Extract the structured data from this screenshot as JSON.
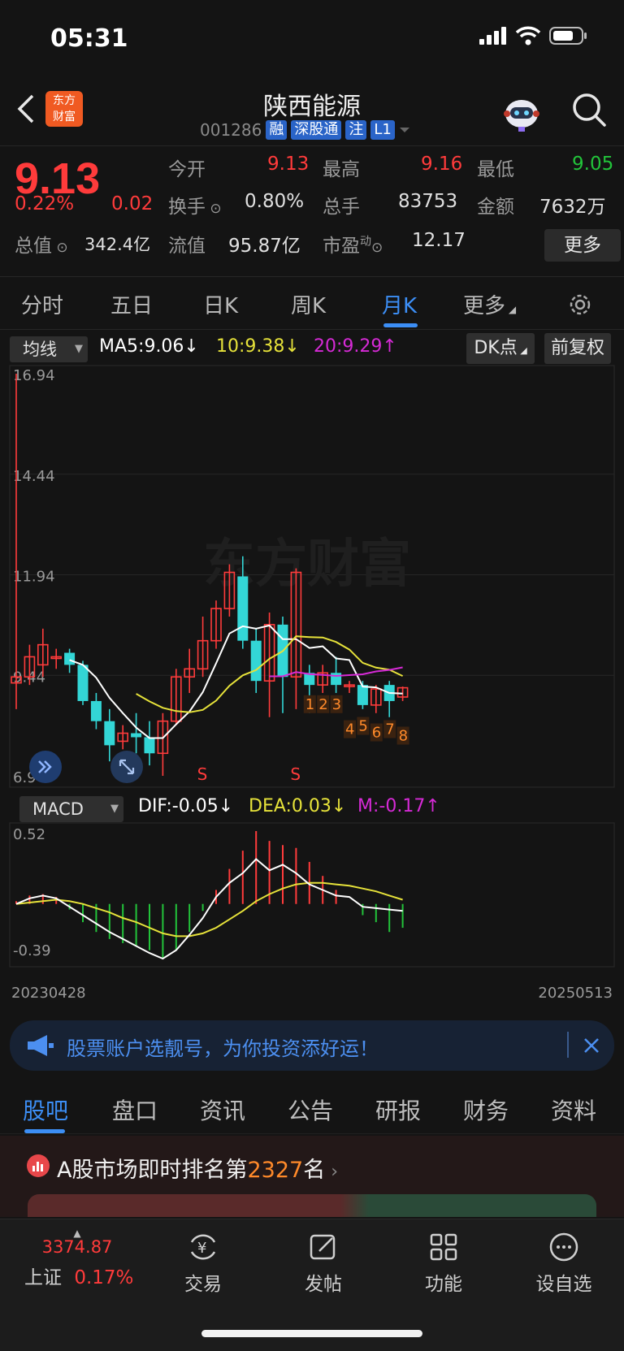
{
  "status": {
    "time": "05:31"
  },
  "header": {
    "title": "陕西能源",
    "logo_text_1": "东方",
    "logo_text_2": "财富",
    "code": "001286",
    "tags": [
      "融",
      "深股通",
      "注",
      "L1"
    ]
  },
  "quote": {
    "price": "9.13",
    "change_pct": "0.22%",
    "change": "0.02",
    "open_label": "今开",
    "open": "9.13",
    "high_label": "最高",
    "high": "9.16",
    "low_label": "最低",
    "low": "9.05",
    "turnover_label": "换手",
    "turnover": "0.80%",
    "volume_label": "总手",
    "volume": "83753",
    "amount_label": "金额",
    "amount": "7632万",
    "mcap_label": "总值",
    "mcap": "342.4亿",
    "float_label": "流值",
    "float": "95.87亿",
    "pe_label": "市盈",
    "pe_sup": "动",
    "pe": "12.17",
    "more": "更多"
  },
  "tabs": [
    "分时",
    "五日",
    "日K",
    "周K",
    "月K",
    "更多"
  ],
  "active_tab": "月K",
  "indicators": {
    "main_select": "均线",
    "ma5": "MA5:9.06↓",
    "ma10": "10:9.38↓",
    "ma20": "20:9.29↑",
    "dk_button": "DK点",
    "adjust_button": "前复权",
    "sub_select": "MACD",
    "dif": "DIF:-0.05↓",
    "dea": "DEA:0.03↓",
    "m": "M:-0.17↑"
  },
  "colors": {
    "up": "#ff3b3b",
    "down": "#33d6d6",
    "ma5": "#ffffff",
    "ma10": "#e6e23a",
    "ma20": "#d62ad6",
    "accent": "#3c8ef5"
  },
  "chart_data": [
    {
      "type": "candlestick",
      "title": "",
      "y_ticks": [
        "16.94",
        "14.44",
        "11.94",
        "9.44",
        "6.94"
      ],
      "ylim": [
        6.94,
        16.94
      ],
      "x_range": [
        "20230428",
        "20250513"
      ],
      "watermark": "东方财富",
      "markers": [
        "S",
        "S"
      ],
      "count_labels": [
        "1",
        "2",
        "3",
        "4",
        "5",
        "6",
        "7",
        "8"
      ],
      "candles": [
        {
          "o": 9.25,
          "c": 9.4,
          "h": 16.94,
          "l": 8.6
        },
        {
          "o": 9.4,
          "c": 9.9,
          "h": 10.2,
          "l": 9.2
        },
        {
          "o": 9.7,
          "c": 10.2,
          "h": 10.6,
          "l": 9.4
        },
        {
          "o": 9.9,
          "c": 9.9,
          "h": 10.1,
          "l": 9.6
        },
        {
          "o": 10.0,
          "c": 9.7,
          "h": 10.1,
          "l": 9.5
        },
        {
          "o": 9.7,
          "c": 8.8,
          "h": 9.8,
          "l": 8.7
        },
        {
          "o": 8.8,
          "c": 8.3,
          "h": 9.0,
          "l": 8.1
        },
        {
          "o": 8.3,
          "c": 7.7,
          "h": 8.6,
          "l": 7.3
        },
        {
          "o": 7.8,
          "c": 8.0,
          "h": 8.2,
          "l": 7.6
        },
        {
          "o": 8.0,
          "c": 7.9,
          "h": 8.5,
          "l": 7.5
        },
        {
          "o": 7.9,
          "c": 7.5,
          "h": 8.3,
          "l": 7.2
        },
        {
          "o": 7.5,
          "c": 8.3,
          "h": 8.5,
          "l": 6.94
        },
        {
          "o": 8.3,
          "c": 9.4,
          "h": 9.6,
          "l": 8.2
        },
        {
          "o": 9.4,
          "c": 9.6,
          "h": 10.1,
          "l": 9.0
        },
        {
          "o": 9.6,
          "c": 10.3,
          "h": 10.9,
          "l": 9.4
        },
        {
          "o": 10.3,
          "c": 11.1,
          "h": 11.3,
          "l": 10.1
        },
        {
          "o": 11.1,
          "c": 12.0,
          "h": 12.2,
          "l": 10.9
        },
        {
          "o": 11.9,
          "c": 10.3,
          "h": 12.4,
          "l": 10.1
        },
        {
          "o": 10.3,
          "c": 9.3,
          "h": 10.6,
          "l": 9.0
        },
        {
          "o": 9.3,
          "c": 10.7,
          "h": 11.0,
          "l": 8.4
        },
        {
          "o": 10.7,
          "c": 9.4,
          "h": 10.9,
          "l": 8.5
        },
        {
          "o": 9.4,
          "c": 12.0,
          "h": 12.1,
          "l": 8.6
        },
        {
          "o": 9.5,
          "c": 9.2,
          "h": 9.7,
          "l": 8.5
        },
        {
          "o": 9.2,
          "c": 9.5,
          "h": 9.7,
          "l": 9.0
        },
        {
          "o": 9.5,
          "c": 9.2,
          "h": 9.9,
          "l": 9.0
        },
        {
          "o": 9.2,
          "c": 9.2,
          "h": 9.3,
          "l": 9.0
        },
        {
          "o": 9.2,
          "c": 8.7,
          "h": 9.3,
          "l": 8.6
        },
        {
          "o": 8.7,
          "c": 9.1,
          "h": 9.2,
          "l": 8.5
        },
        {
          "o": 9.2,
          "c": 8.8,
          "h": 9.3,
          "l": 8.4
        },
        {
          "o": 8.9,
          "c": 9.13,
          "h": 9.16,
          "l": 8.8
        }
      ]
    },
    {
      "type": "macd",
      "y_ticks": [
        "0.52",
        "-0.39"
      ],
      "ylim": [
        -0.39,
        0.52
      ],
      "hist": [
        0.02,
        0.06,
        0.07,
        0.05,
        -0.04,
        -0.13,
        -0.2,
        -0.25,
        -0.28,
        -0.3,
        -0.33,
        -0.39,
        -0.33,
        -0.2,
        -0.05,
        0.1,
        0.25,
        0.38,
        0.52,
        0.45,
        0.42,
        0.4,
        0.3,
        0.2,
        0.1,
        0.0,
        -0.08,
        -0.13,
        -0.2,
        -0.17
      ],
      "dif": [
        0.0,
        0.04,
        0.06,
        0.04,
        -0.02,
        -0.08,
        -0.14,
        -0.2,
        -0.25,
        -0.3,
        -0.35,
        -0.39,
        -0.33,
        -0.22,
        -0.1,
        0.05,
        0.15,
        0.22,
        0.32,
        0.24,
        0.28,
        0.22,
        0.14,
        0.1,
        0.06,
        0.05,
        -0.02,
        -0.03,
        -0.04,
        -0.05
      ],
      "dea": [
        0.0,
        0.01,
        0.02,
        0.03,
        0.02,
        0.0,
        -0.03,
        -0.06,
        -0.1,
        -0.13,
        -0.17,
        -0.21,
        -0.23,
        -0.23,
        -0.21,
        -0.17,
        -0.11,
        -0.05,
        0.02,
        0.07,
        0.11,
        0.14,
        0.15,
        0.15,
        0.14,
        0.13,
        0.11,
        0.09,
        0.06,
        0.03
      ]
    }
  ],
  "banner": {
    "text": "股票账户选靓号，为你投资添好运！"
  },
  "tabs2": [
    "股吧",
    "盘口",
    "资讯",
    "公告",
    "研报",
    "财务",
    "资料"
  ],
  "rank": {
    "prefix": "A股市场即时排名第",
    "number": "2327",
    "suffix": "名"
  },
  "bottombar": {
    "index_value": "3374.87",
    "index_name": "上证",
    "index_change": "0.17%",
    "trade": "交易",
    "post": "发帖",
    "function": "功能",
    "watchlist": "设自选"
  }
}
